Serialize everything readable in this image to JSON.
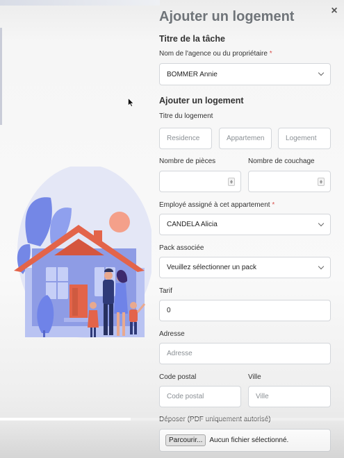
{
  "modal": {
    "title": "Ajouter un logement",
    "close_symbol": "×"
  },
  "task_section": {
    "heading": "Titre de la tâche",
    "owner_label": "Nom de l'agence ou du propriétaire",
    "required_mark": "*",
    "owner_value": "BOMMER Annie"
  },
  "housing_section": {
    "heading": "Ajouter un logement",
    "title_label": "Titre du logement",
    "residence_placeholder": "Residence",
    "apartment_placeholder": "Appartemen",
    "housing_placeholder": "Logement",
    "rooms_label": "Nombre de pièces",
    "beds_label": "Nombre de couchage",
    "employee_label": "Employé assigné à cet appartement",
    "employee_value": "CANDELA Alicia",
    "pack_label": "Pack associée",
    "pack_value": "Veuillez sélectionner un pack",
    "price_label": "Tarif",
    "price_value": "0",
    "address_label": "Adresse",
    "address_placeholder": "Adresse",
    "postal_label": "Code postal",
    "postal_placeholder": "Code postal",
    "city_label": "Ville",
    "city_placeholder": "Ville",
    "upload_label": "Déposer (PDF uniquement autorisé)",
    "browse_label": "Parcourir...",
    "no_file_text": "Aucun fichier sélectionné."
  },
  "video_progress": {
    "buffered_fraction": 0.38
  },
  "colors": {
    "title_gray": "#6f7479",
    "required_red": "#d9534f",
    "roof_orange": "#e3644a",
    "house_blue": "#8594e0",
    "leaf_blue": "#6f83e8"
  },
  "icons": {
    "close": "close-icon",
    "select_arrow": "chevron-down-icon",
    "number_spinner": "spinner-icon",
    "cursor": "mouse-pointer-icon",
    "illustration": "family-house-illustration"
  }
}
